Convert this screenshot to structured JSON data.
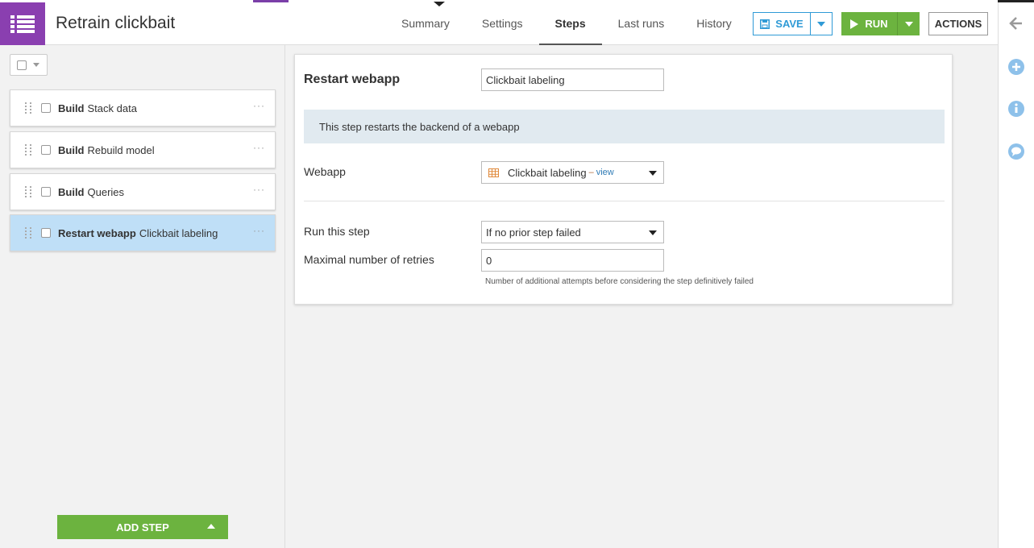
{
  "header": {
    "title": "Retrain clickbait",
    "tabs": [
      {
        "label": "Summary",
        "active": false
      },
      {
        "label": "Settings",
        "active": false
      },
      {
        "label": "Steps",
        "active": true
      },
      {
        "label": "Last runs",
        "active": false
      },
      {
        "label": "History",
        "active": false
      }
    ],
    "save_label": "SAVE",
    "run_label": "RUN",
    "actions_label": "ACTIONS"
  },
  "colors": {
    "brand_purple": "#8a3fb0",
    "save_blue": "#2f9ad6",
    "run_green": "#6cb33f",
    "selected_step": "#bfdff7",
    "info_bg": "#e1eaf0"
  },
  "sidebar": {
    "steps": [
      {
        "type": "Build",
        "name": "Stack data",
        "selected": false
      },
      {
        "type": "Build",
        "name": "Rebuild model",
        "selected": false
      },
      {
        "type": "Build",
        "name": "Queries",
        "selected": false
      },
      {
        "type": "Restart webapp",
        "name": "Clickbait labeling",
        "selected": true
      }
    ],
    "add_step_label": "ADD STEP"
  },
  "main": {
    "title": "Restart webapp",
    "name_value": "Clickbait labeling",
    "info": "This step restarts the backend of a webapp",
    "webapp_label": "Webapp",
    "webapp_value": "Clickbait labeling",
    "webapp_dash": "–",
    "webapp_link": "view",
    "run_step_label": "Run this step",
    "run_step_value": "If no prior step failed",
    "retries_label": "Maximal number of retries",
    "retries_value": "0",
    "retries_help": "Number of additional attempts before considering the step definitively failed"
  },
  "icons": {
    "app": "list-icon",
    "save": "floppy-disk-icon",
    "run": "play-icon",
    "rail": [
      "arrow-left-icon",
      "plus-circle-icon",
      "info-circle-icon",
      "chat-bubble-icon"
    ],
    "webapp": "table-grid-icon"
  }
}
